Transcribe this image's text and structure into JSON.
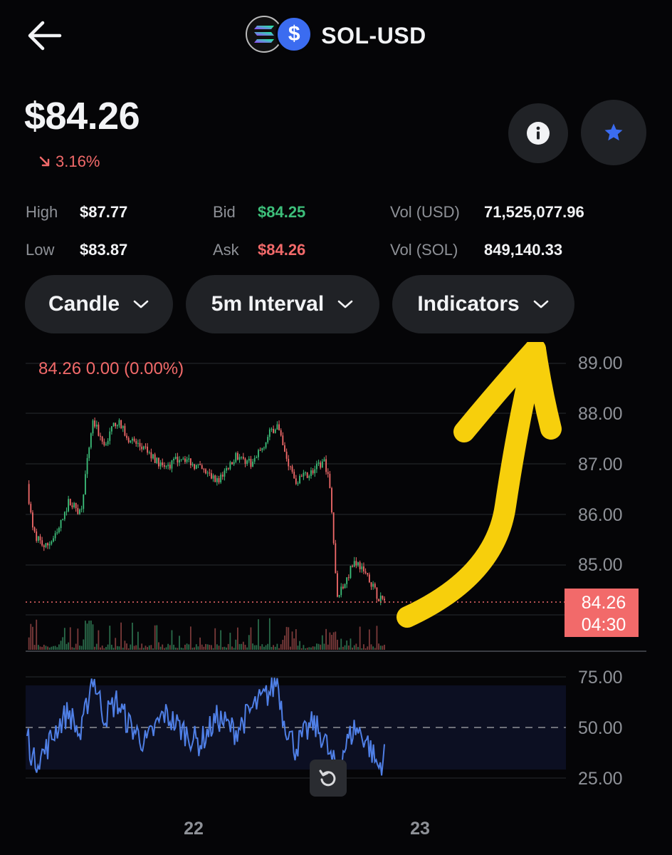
{
  "header": {
    "title": "SOL-USD",
    "logo_symbol": "$",
    "icons": {
      "back": "arrow-left-icon",
      "info": "info-icon",
      "favorite": "star-icon"
    }
  },
  "price": {
    "value": "$84.26",
    "change": "3.16%",
    "direction": "down"
  },
  "stats": {
    "high_label": "High",
    "high_value": "$87.77",
    "low_label": "Low",
    "low_value": "$83.87",
    "bid_label": "Bid",
    "bid_value": "$84.25",
    "ask_label": "Ask",
    "ask_value": "$84.26",
    "vol_usd_label": "Vol (USD)",
    "vol_usd_value": "71,525,077.96",
    "vol_sol_label": "Vol (SOL)",
    "vol_sol_value": "849,140.33"
  },
  "controls": {
    "chart_type": "Candle",
    "interval": "5m Interval",
    "indicators": "Indicators"
  },
  "chart": {
    "ohlc_readout": "84.26  0.00 (0.00%)",
    "price_ticks": [
      "89.00",
      "88.00",
      "87.00",
      "86.00",
      "85.00"
    ],
    "rsi_ticks": [
      "75.00",
      "50.00",
      "25.00"
    ],
    "date_ticks": [
      "22",
      "23"
    ],
    "current_price_tag": "84.26",
    "countdown_tag": "04:30",
    "colors": {
      "up": "#3dbf7a",
      "down": "#f26a6a",
      "rsi": "#4f7fe6",
      "annotation": "#f7cf0c",
      "accent": "#3b6cf0"
    }
  },
  "chart_data": {
    "type": "line",
    "title": "",
    "ylim": [
      83.6,
      89.2
    ],
    "price_path": [
      [
        0,
        86.55
      ],
      [
        1,
        85.6
      ],
      [
        3,
        85.3
      ],
      [
        5,
        85.55
      ],
      [
        7,
        86.2
      ],
      [
        9,
        86.0
      ],
      [
        11,
        87.8
      ],
      [
        13,
        87.3
      ],
      [
        15,
        87.8
      ],
      [
        17,
        87.45
      ],
      [
        20,
        87.2
      ],
      [
        23,
        86.85
      ],
      [
        26,
        87.1
      ],
      [
        29,
        86.85
      ],
      [
        32,
        86.6
      ],
      [
        35,
        87.1
      ],
      [
        38,
        86.95
      ],
      [
        41,
        87.6
      ],
      [
        42,
        87.7
      ],
      [
        43,
        87.25
      ],
      [
        45,
        86.6
      ],
      [
        48,
        86.8
      ],
      [
        50,
        87.0
      ],
      [
        51,
        86.4
      ],
      [
        52,
        84.3
      ],
      [
        53,
        84.5
      ],
      [
        55,
        85.05
      ],
      [
        57,
        84.8
      ],
      [
        59,
        84.3
      ],
      [
        60,
        84.26
      ]
    ],
    "rsi": {
      "ylim": [
        20,
        80
      ],
      "path": [
        [
          0,
          48
        ],
        [
          1,
          33
        ],
        [
          3,
          38
        ],
        [
          5,
          50
        ],
        [
          7,
          58
        ],
        [
          9,
          45
        ],
        [
          11,
          76
        ],
        [
          13,
          55
        ],
        [
          15,
          63
        ],
        [
          17,
          52
        ],
        [
          20,
          42
        ],
        [
          23,
          57
        ],
        [
          26,
          49
        ],
        [
          29,
          42
        ],
        [
          32,
          55
        ],
        [
          35,
          48
        ],
        [
          38,
          60
        ],
        [
          41,
          68
        ],
        [
          42,
          74
        ],
        [
          43,
          55
        ],
        [
          45,
          40
        ],
        [
          48,
          52
        ],
        [
          50,
          44
        ],
        [
          51,
          34
        ],
        [
          52,
          30
        ],
        [
          53,
          38
        ],
        [
          55,
          50
        ],
        [
          57,
          44
        ],
        [
          59,
          30
        ],
        [
          60,
          36
        ]
      ]
    }
  }
}
